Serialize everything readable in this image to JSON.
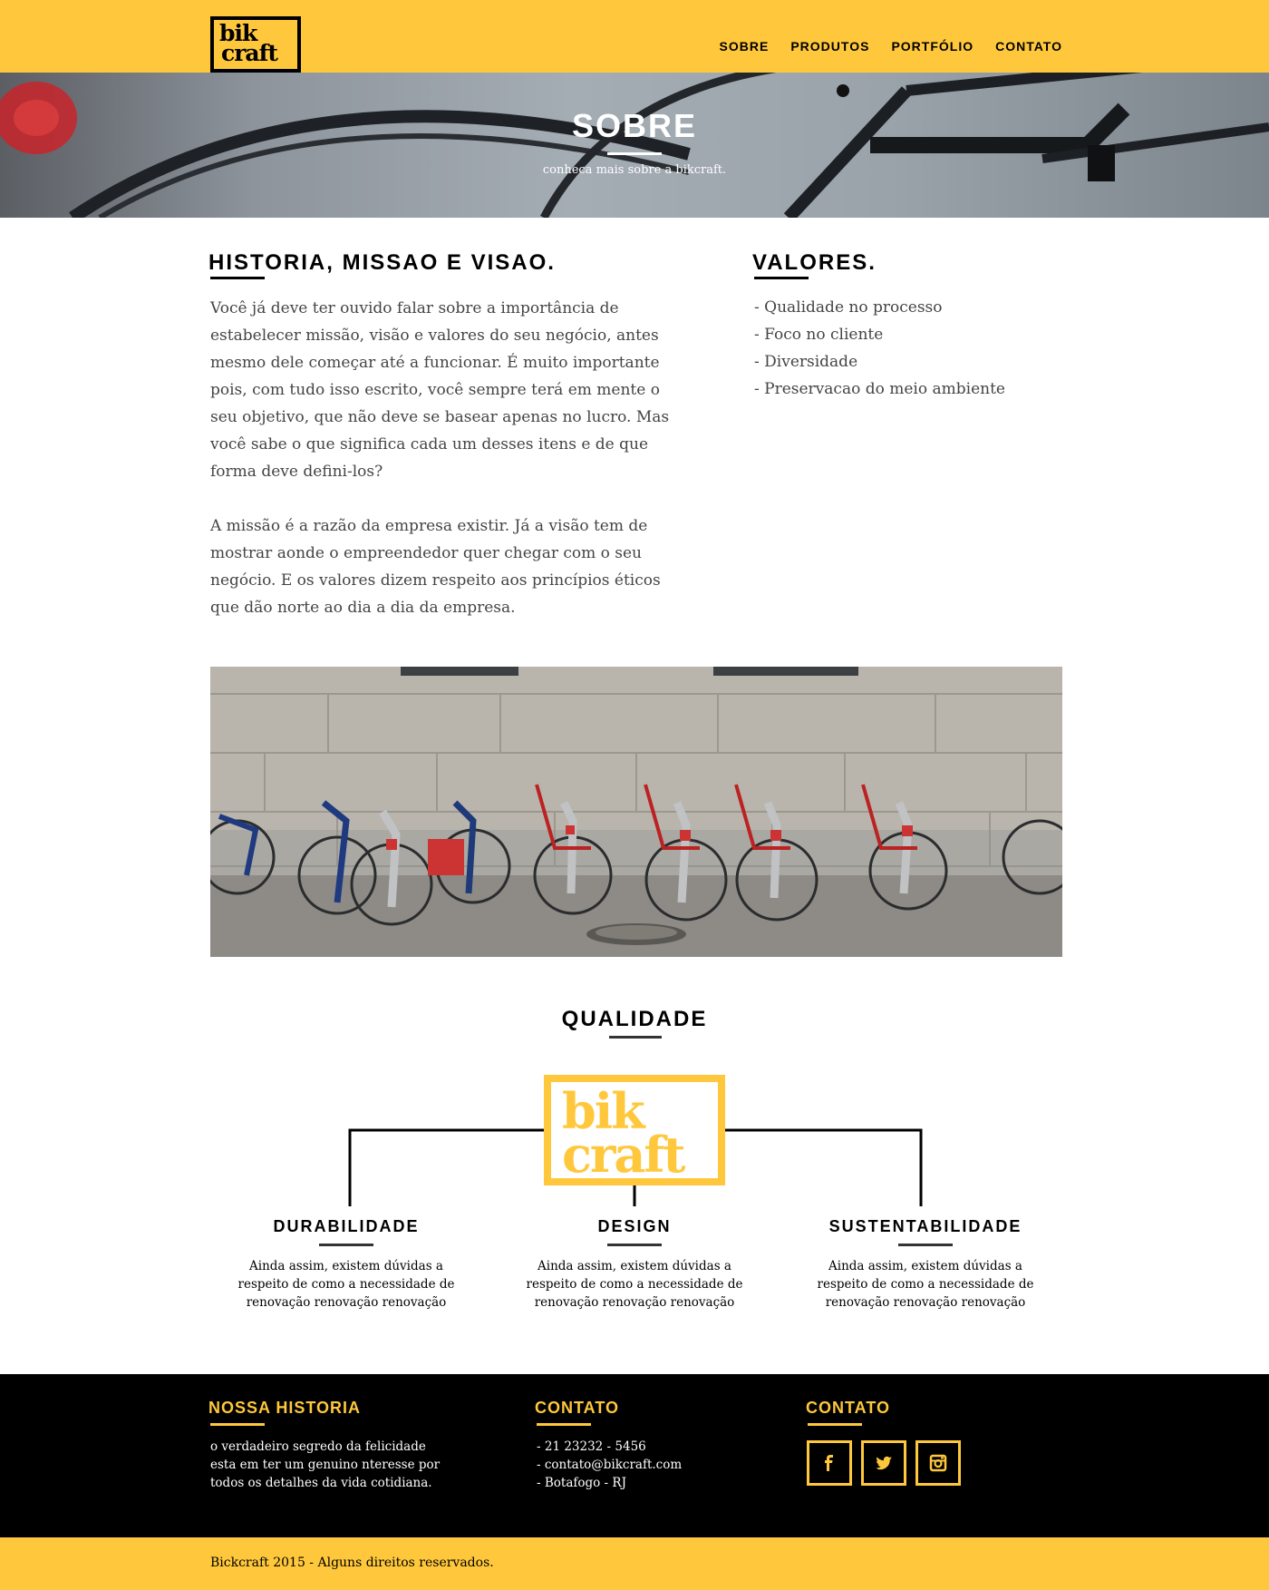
{
  "brand": {
    "line1": "bik",
    "line2": "craft",
    "accent": "#FFC83C"
  },
  "nav": {
    "items": [
      "SOBRE",
      "PRODUTOS",
      "PORTFÓLIO",
      "CONTATO"
    ]
  },
  "hero": {
    "title": "SOBRE",
    "subtitle": "conheca mais sobre a bikcraft."
  },
  "historia": {
    "title": "HISTORIA, MISSAO E VISAO.",
    "paragraphs": [
      "Você já deve ter ouvido falar sobre a importância de estabelecer missão, visão e valores do seu negócio, antes mesmo dele começar até a funcionar. É muito importante pois, com tudo isso escrito, você sempre terá em mente o seu objetivo, que não deve se basear apenas no lucro. Mas você sabe o que significa cada um desses itens e de que forma deve defini-los?",
      "A missão é a razão da empresa existir. Já a visão tem de mostrar aonde o empreendedor quer chegar com o seu negócio. E os valores dizem respeito aos princípios éticos que dão norte ao dia a dia da empresa."
    ]
  },
  "valores": {
    "title": "VALORES.",
    "items": [
      "- Qualidade no processo",
      "- Foco no cliente",
      "- Diversidade",
      "- Preservacao do meio ambiente"
    ]
  },
  "qualidade": {
    "title": "QUALIDADE",
    "features": [
      {
        "title": "DURABILIDADE",
        "text": "Ainda assim, existem dúvidas a respeito de como a necessidade de renovação renovação renovação"
      },
      {
        "title": "DESIGN",
        "text": "Ainda assim, existem dúvidas a respeito de como a necessidade de renovação renovação renovação"
      },
      {
        "title": "SUSTENTABILIDADE",
        "text": "Ainda assim, existem dúvidas a respeito de como a necessidade de renovação renovação renovação"
      }
    ]
  },
  "footer": {
    "historia": {
      "title": "NOSSA HISTORIA",
      "text": "o verdadeiro segredo da felicidade esta em ter um genuino nteresse por todos os detalhes da vida cotidiana."
    },
    "contato": {
      "title": "CONTATO",
      "items": [
        "- 21 23232 - 5456",
        "- contato@bikcraft.com",
        "- Botafogo - RJ"
      ]
    },
    "social": {
      "title": "CONTATO",
      "icons": [
        "facebook-icon",
        "twitter-icon",
        "instagram-icon"
      ]
    },
    "copyright": "Bickcraft 2015 - Alguns direitos reservados."
  }
}
